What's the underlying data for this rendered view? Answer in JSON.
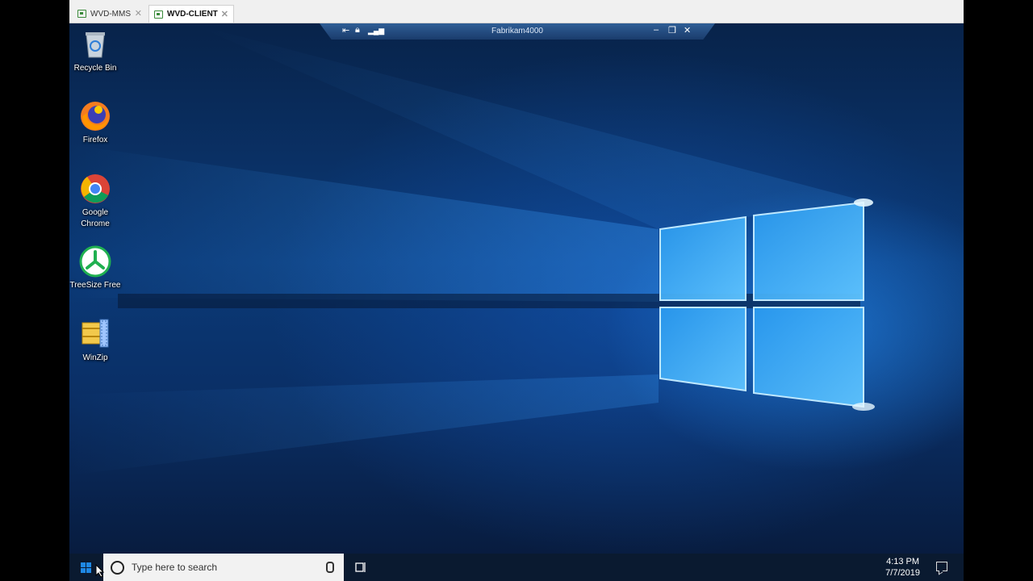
{
  "tabs": [
    {
      "label": "WVD-MMS",
      "active": false
    },
    {
      "label": "WVD-CLIENT",
      "active": true
    }
  ],
  "remote_bar": {
    "title": "Fabrikam4000"
  },
  "desktop_icons": [
    {
      "label": "Recycle Bin",
      "icon": "recycle-bin-icon"
    },
    {
      "label": "Firefox",
      "icon": "firefox-icon"
    },
    {
      "label": "Google\nChrome",
      "icon": "chrome-icon"
    },
    {
      "label": "TreeSize Free",
      "icon": "treesize-icon"
    },
    {
      "label": "WinZip",
      "icon": "winzip-icon"
    }
  ],
  "taskbar": {
    "search_placeholder": "Type here to search",
    "time": "4:13 PM",
    "date": "7/7/2019"
  },
  "colors": {
    "taskbar": "#0a1a30",
    "desktop_blue": "#0b3a78",
    "accent": "#1e88e5"
  }
}
